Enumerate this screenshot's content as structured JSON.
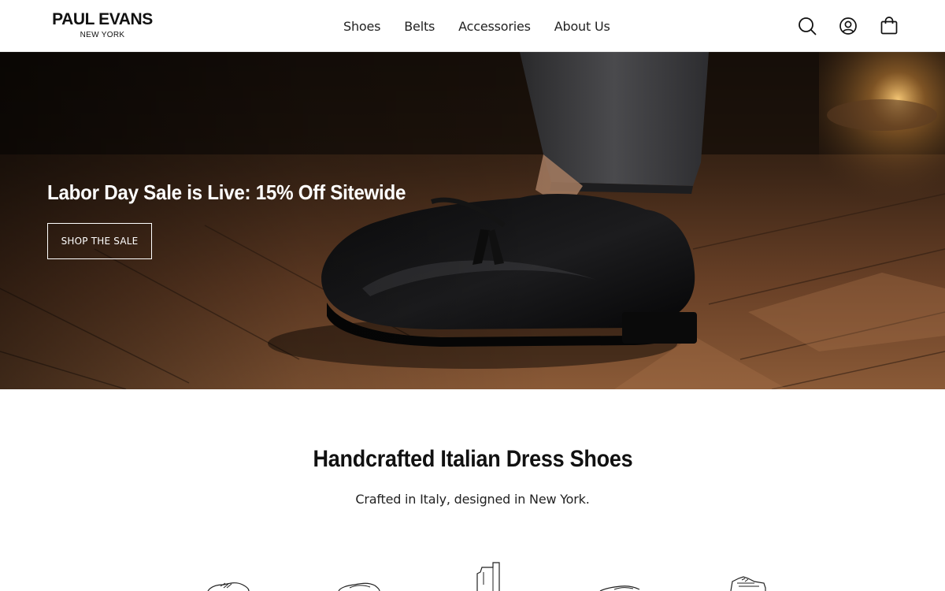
{
  "brand": {
    "name": "PAUL EVANS",
    "location": "NEW YORK"
  },
  "nav": {
    "items": [
      {
        "label": "Shoes"
      },
      {
        "label": "Belts"
      },
      {
        "label": "Accessories"
      },
      {
        "label": "About Us"
      }
    ]
  },
  "header_icons": [
    "search-icon",
    "account-icon",
    "cart-icon"
  ],
  "hero": {
    "title": "Labor Day Sale is Live: 15% Off Sitewide",
    "button_label": "SHOP THE SALE"
  },
  "intro": {
    "title": "Handcrafted Italian Dress Shoes",
    "subtitle": "Crafted in Italy, designed in New York."
  },
  "category_icons": [
    "oxford-shoe-icon",
    "loafer-icon",
    "boot-icon",
    "slipper-icon",
    "sneaker-icon"
  ],
  "colors": {
    "text": "#111111",
    "background": "#ffffff",
    "hero_overlay_text": "#ffffff"
  }
}
